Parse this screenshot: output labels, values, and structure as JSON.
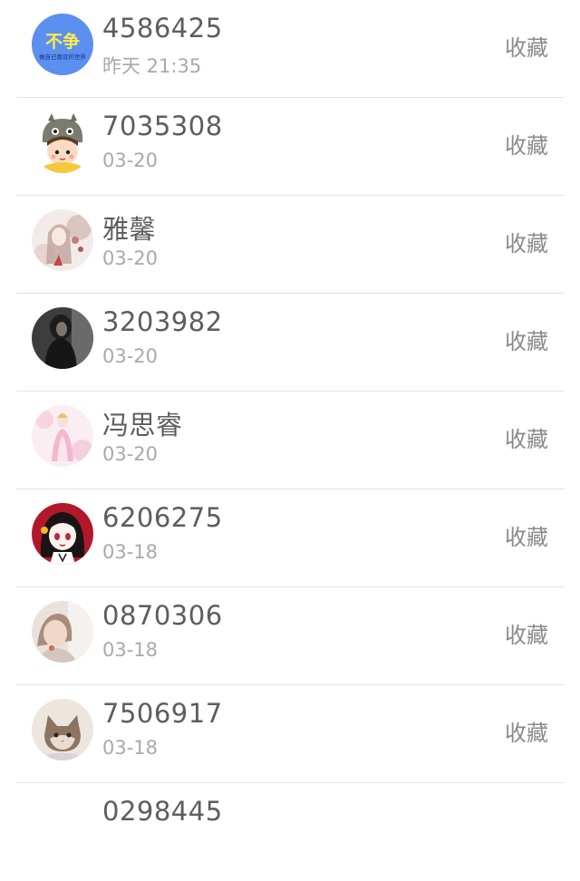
{
  "contacts": [
    {
      "name": "4586425",
      "time": "昨天 21:35",
      "action": "收藏",
      "avatar_icon": "bu-zheng-text-avatar-icon",
      "avatar_text": "不争",
      "avatar_subtext": "做自己喜欢的世界",
      "avatar_color": "#5b8ff0"
    },
    {
      "name": "7035308",
      "time": "03-20",
      "action": "收藏",
      "avatar_icon": "totoro-hat-cartoon-avatar-icon"
    },
    {
      "name": "雅馨",
      "time": "03-20",
      "action": "收藏",
      "avatar_icon": "girl-flowers-avatar-icon"
    },
    {
      "name": "3203982",
      "time": "03-20",
      "action": "收藏",
      "avatar_icon": "dark-figure-avatar-icon"
    },
    {
      "name": "冯思睿",
      "time": "03-20",
      "action": "收藏",
      "avatar_icon": "pink-princess-avatar-icon"
    },
    {
      "name": "6206275",
      "time": "03-18",
      "action": "收藏",
      "avatar_icon": "anime-girl-red-avatar-icon"
    },
    {
      "name": "0870306",
      "time": "03-18",
      "action": "收藏",
      "avatar_icon": "blurred-girl-photo-avatar-icon"
    },
    {
      "name": "7506917",
      "time": "03-18",
      "action": "收藏",
      "avatar_icon": "cat-photo-avatar-icon"
    },
    {
      "name": "0298445",
      "time": "",
      "action": "",
      "avatar_icon": ""
    }
  ]
}
